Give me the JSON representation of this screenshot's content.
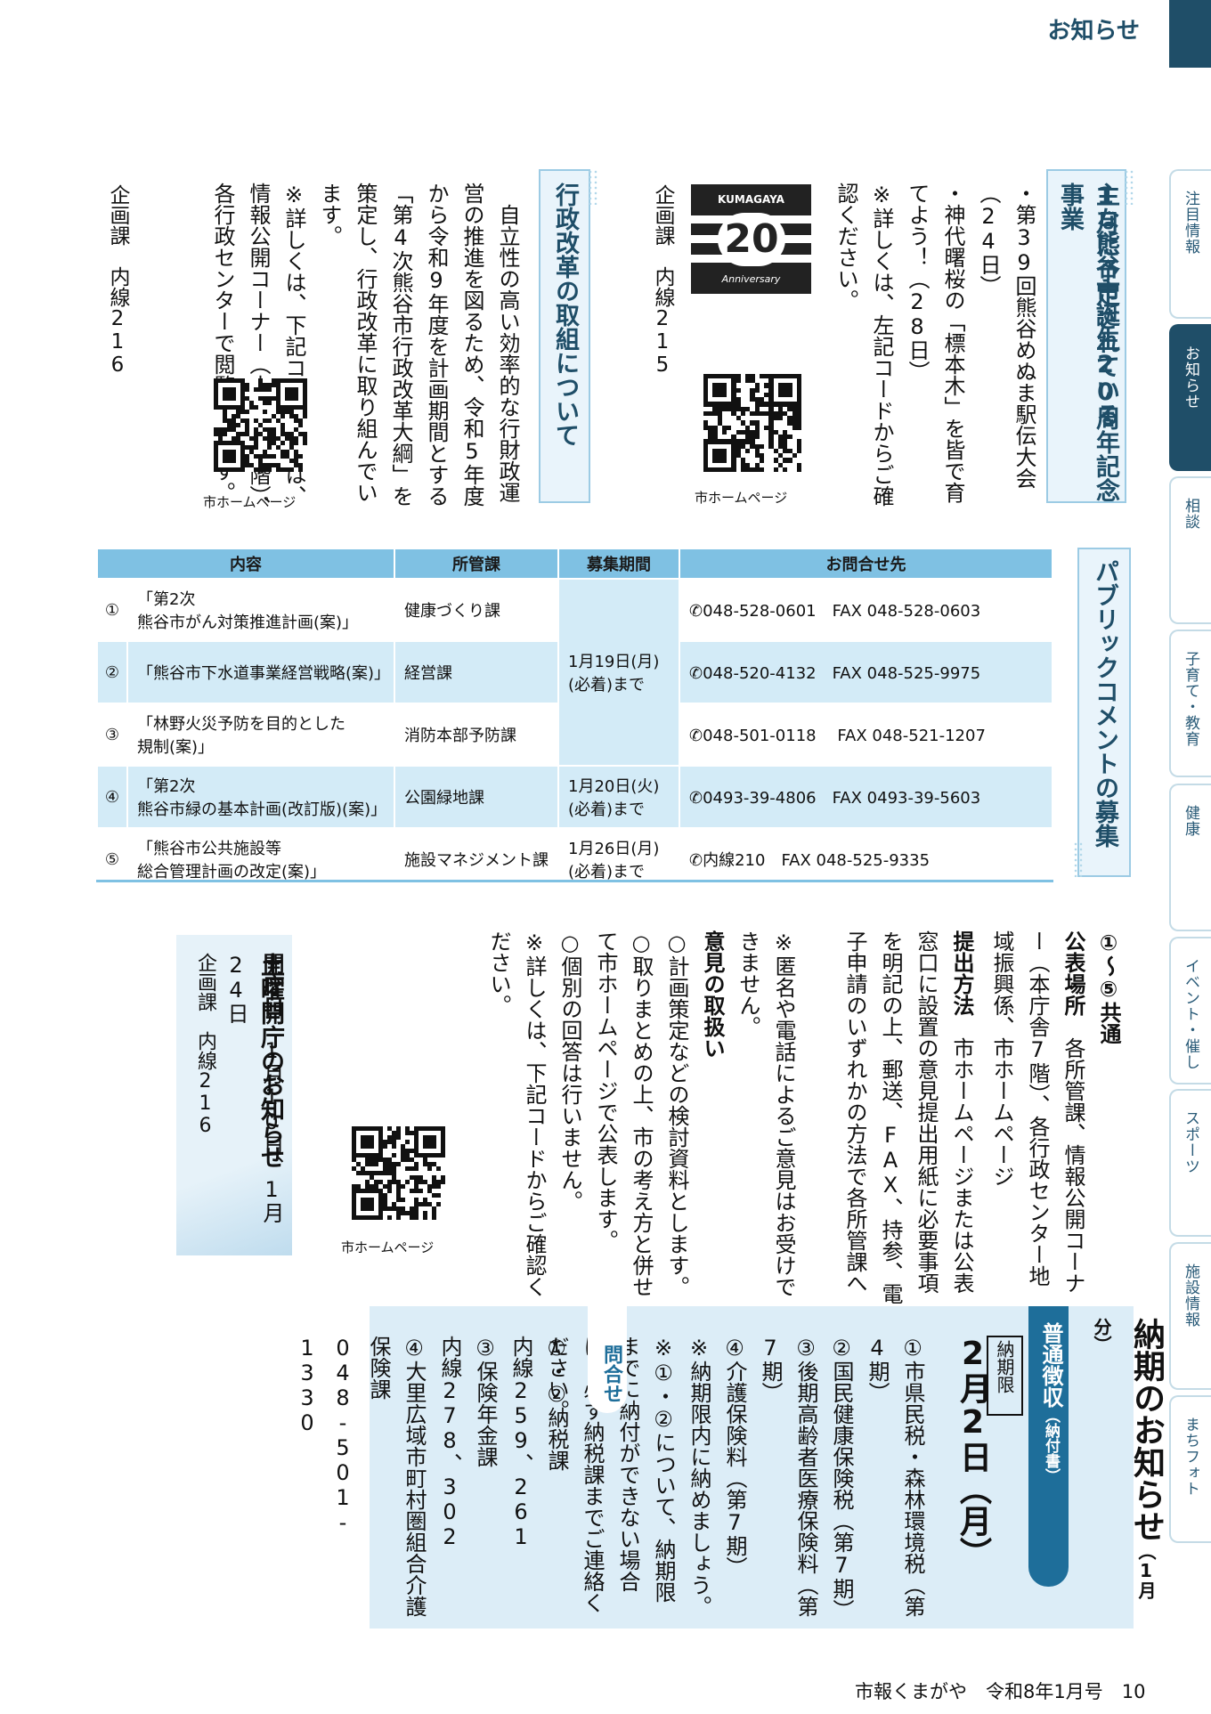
{
  "header": {
    "page_label": "お知らせ"
  },
  "side_tabs": [
    "注目情報",
    "お知らせ",
    "相談",
    "子育て・教育",
    "健康",
    "イベント・催し",
    "スポーツ",
    "施設情報",
    "まちフォト"
  ],
  "anniversary": {
    "title_line1": "1月に予定されている",
    "title_line2": "主な熊谷市誕生20周年記念事業",
    "body": "・第39回熊谷めぬま駅伝大会（24日）\n・神代曙桜の「標本木」を皆で育てよう！（28日）\n※詳しくは、左記コードからご確認ください。",
    "logo_top": "KUMAGAYA",
    "logo_num": "20",
    "logo_sub": "Anniversary",
    "qr_caption": "市ホームページ",
    "contact": "企画課　内線215"
  },
  "reform": {
    "title": "行政改革の取組について",
    "body": "　自立性の高い効率的な行財政運営の推進を図るため、令和5年度から令和9年度を計画期間とする「第4次熊谷市行政改革大綱」を策定し、行政改革に取り組んでいます。\n※詳しくは、下記コードまたは、情報公開コーナー（本庁舎7階）、各行政センターで閲覧できます。",
    "qr_caption": "市ホームページ",
    "contact": "企画課　内線216"
  },
  "public_comment": {
    "title": "パブリックコメントの募集",
    "headers": [
      "内容",
      "所管課",
      "募集期間",
      "お問合せ先"
    ],
    "rows": [
      {
        "no": "①",
        "content": "「第2次\n熊谷市がん対策推進計画(案)」",
        "dept": "健康づくり課",
        "contact": "048-528-0601　FAX 048-528-0603"
      },
      {
        "no": "②",
        "content": "「熊谷市下水道事業経営戦略(案)」",
        "dept": "経営課",
        "contact": "048-520-4132　FAX 048-525-9975"
      },
      {
        "no": "③",
        "content": "「林野火災予防を目的とした\n規制(案)」",
        "dept": "消防本部予防課",
        "contact": "048-501-0118　 FAX 048-521-1207"
      },
      {
        "no": "④",
        "content": "「第2次\n熊谷市緑の基本計画(改訂版)(案)」",
        "dept": "公園緑地課",
        "contact": "0493-39-4806　FAX 0493-39-5603"
      },
      {
        "no": "⑤",
        "content": "「熊谷市公共施設等\n総合管理計画の改定(案)」",
        "dept": "施設マネジメント課",
        "contact": "内線210　FAX 048-525-9335"
      }
    ],
    "periods": [
      "1月19日(月)\n(必着)まで",
      "1月20日(火)\n(必着)まで",
      "1月26日(月)\n(必着)まで"
    ],
    "common_title": "①〜⑤共通",
    "publish_label": "公表場所",
    "publish_text": "各所管課、情報公開コーナー（本庁舎7階）、各行政センター地域振興係、市ホームページ",
    "submit_label": "提出方法",
    "submit_text": "市ホームページまたは公表窓口に設置の意見提出用紙に必要事項を明記の上、郵送、FAX、持参、電子申請のいずれかの方法で各所管課へ",
    "note1": "※匿名や電話によるご意見はお受けできません。",
    "handling_label": "意見の取扱い",
    "handling": "○計画策定などの検討資料とします。\n○取りまとめの上、市の考え方と併せて市ホームページで公表します。\n○個別の回答は行いません。\n※詳しくは、下記コードからご確認ください。",
    "qr_caption": "市ホームページ"
  },
  "saturday": {
    "title": "土曜開庁のお知らせ",
    "days_label": "開庁日",
    "days": "1月10日、1月24日",
    "contact": "企画課　内線216"
  },
  "payment": {
    "title": "納期のお知らせ",
    "title_sub": "（1月分）",
    "type": "普通徴収",
    "type_sub": "（納付書）",
    "deadline_label": "納期限",
    "deadline": "2月2日（月）",
    "items": "①市県民税・森林環境税（第4期）\n②国民健康保険税（第7期）\n③後期高齢者医療保険料（第7期）\n④介護保険料（第7期）\n※納期限内に納めましょう。\n※①・②について、納期限までに納付ができない場合は、必ず納税課までご連絡ください。",
    "inquiry_label": "問合せ",
    "inquiry": "①・②納税課\n内線259、261\n③保険年金課\n内線278、302\n④大里広域市町村圏組合介護保険課\n048-501-1330"
  },
  "footer": {
    "text": "市報くまがや　令和8年1月号　10"
  }
}
